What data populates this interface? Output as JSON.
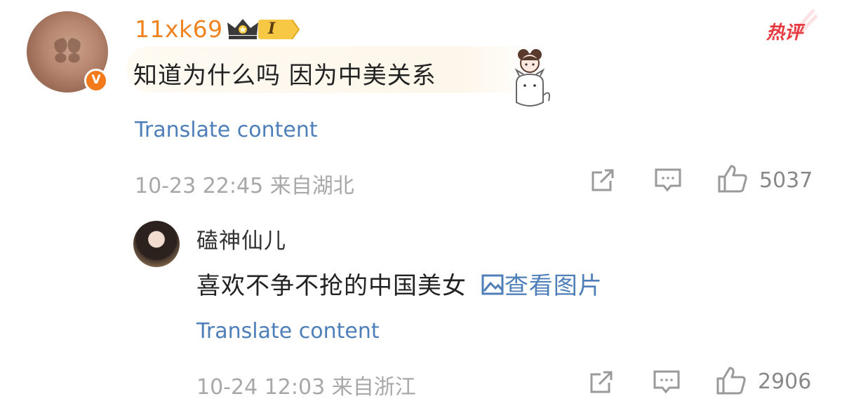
{
  "comment1": {
    "username": "11xk69",
    "level_label": "I",
    "verified_badge": "V",
    "hot_tag": "热评",
    "content": "知道为什么吗 因为中美关系",
    "translate": "Translate content",
    "meta": "10-23 22:45 来自湖北",
    "likes": "5037",
    "colors": {
      "username": "#f0831f",
      "hot": "#e6393f",
      "link": "#4f7fb8"
    }
  },
  "reply1": {
    "username": "磕神仙儿",
    "content": "喜欢不争不抢的中国美女",
    "image_link": "查看图片",
    "translate": "Translate content",
    "meta": "10-24 12:03 来自浙江",
    "likes": "2906"
  },
  "icons": [
    "share-icon",
    "comment-icon",
    "like-icon",
    "image-icon",
    "crown-icon"
  ]
}
